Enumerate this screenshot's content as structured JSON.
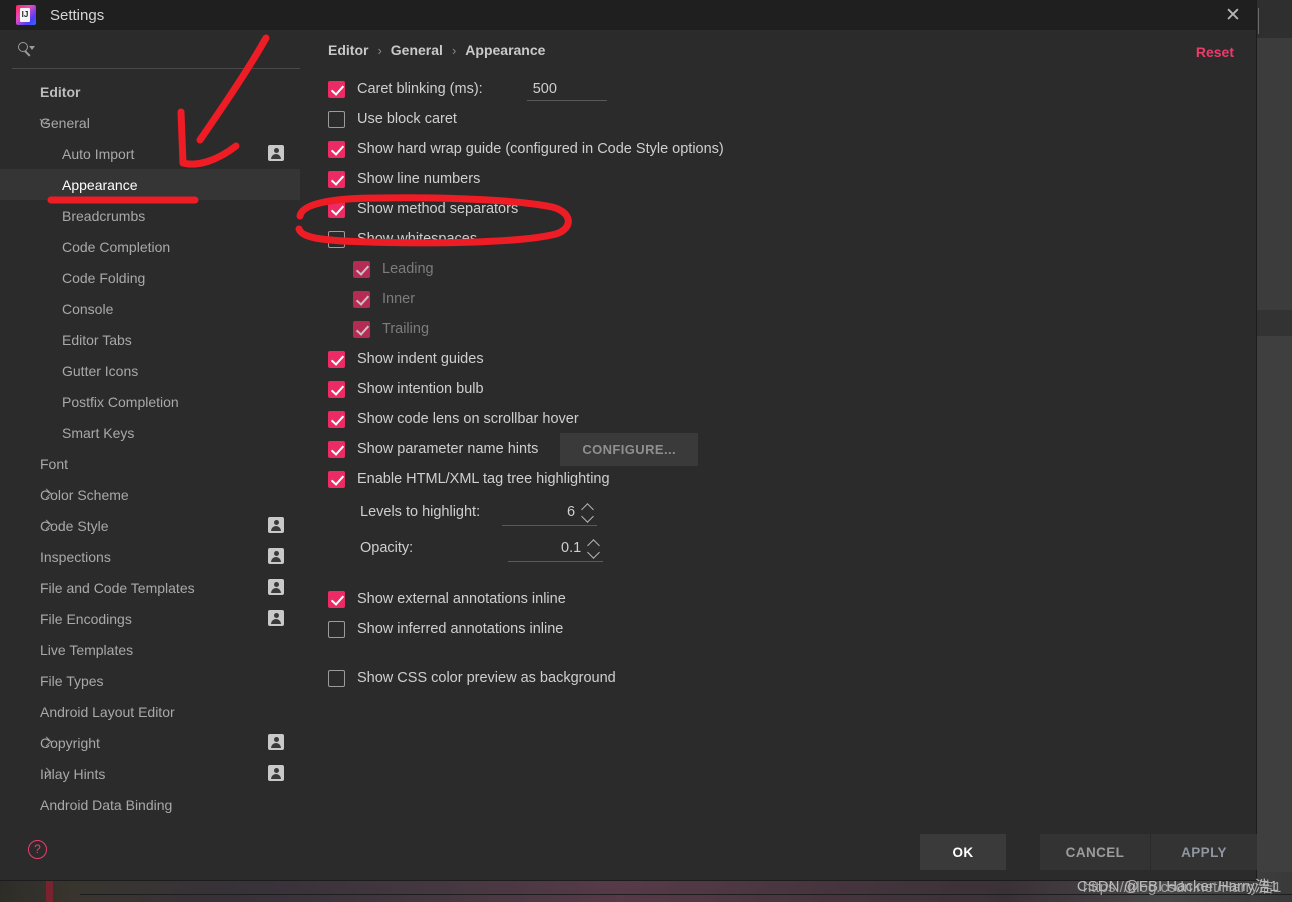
{
  "window": {
    "title": "Settings",
    "logo_icon": "intellij-idea-logo",
    "close_icon": "close-icon"
  },
  "sidebar": {
    "search": {
      "placeholder": "",
      "value": "",
      "icon": "search-icon"
    },
    "items": [
      {
        "label": "Editor",
        "level": 0,
        "chevron": "",
        "badge": false,
        "selected": false
      },
      {
        "label": "General",
        "level": 1,
        "chevron": "open",
        "badge": false,
        "selected": false
      },
      {
        "label": "Auto Import",
        "level": 2,
        "chevron": "",
        "badge": true,
        "selected": false
      },
      {
        "label": "Appearance",
        "level": 2,
        "chevron": "",
        "badge": false,
        "selected": true
      },
      {
        "label": "Breadcrumbs",
        "level": 2,
        "chevron": "",
        "badge": false,
        "selected": false
      },
      {
        "label": "Code Completion",
        "level": 2,
        "chevron": "",
        "badge": false,
        "selected": false
      },
      {
        "label": "Code Folding",
        "level": 2,
        "chevron": "",
        "badge": false,
        "selected": false
      },
      {
        "label": "Console",
        "level": 2,
        "chevron": "",
        "badge": false,
        "selected": false
      },
      {
        "label": "Editor Tabs",
        "level": 2,
        "chevron": "",
        "badge": false,
        "selected": false
      },
      {
        "label": "Gutter Icons",
        "level": 2,
        "chevron": "",
        "badge": false,
        "selected": false
      },
      {
        "label": "Postfix Completion",
        "level": 2,
        "chevron": "",
        "badge": false,
        "selected": false
      },
      {
        "label": "Smart Keys",
        "level": 2,
        "chevron": "",
        "badge": false,
        "selected": false
      },
      {
        "label": "Font",
        "level": 1,
        "chevron": "",
        "badge": false,
        "selected": false
      },
      {
        "label": "Color Scheme",
        "level": 1,
        "chevron": "closed",
        "badge": false,
        "selected": false
      },
      {
        "label": "Code Style",
        "level": 1,
        "chevron": "closed",
        "badge": true,
        "selected": false
      },
      {
        "label": "Inspections",
        "level": 1,
        "chevron": "",
        "badge": true,
        "selected": false
      },
      {
        "label": "File and Code Templates",
        "level": 1,
        "chevron": "",
        "badge": true,
        "selected": false
      },
      {
        "label": "File Encodings",
        "level": 1,
        "chevron": "",
        "badge": true,
        "selected": false
      },
      {
        "label": "Live Templates",
        "level": 1,
        "chevron": "",
        "badge": false,
        "selected": false
      },
      {
        "label": "File Types",
        "level": 1,
        "chevron": "",
        "badge": false,
        "selected": false
      },
      {
        "label": "Android Layout Editor",
        "level": 1,
        "chevron": "",
        "badge": false,
        "selected": false
      },
      {
        "label": "Copyright",
        "level": 1,
        "chevron": "closed",
        "badge": true,
        "selected": false
      },
      {
        "label": "Inlay Hints",
        "level": 1,
        "chevron": "closed",
        "badge": true,
        "selected": false
      },
      {
        "label": "Android Data Binding",
        "level": 1,
        "chevron": "",
        "badge": false,
        "selected": false
      }
    ]
  },
  "main": {
    "breadcrumb": [
      "Editor",
      "General",
      "Appearance"
    ],
    "breadcrumb_separator": "›",
    "reset_label": "Reset",
    "options": [
      {
        "label": "Caret blinking (ms):",
        "checked": true,
        "disabled": false,
        "sub": false,
        "field": "500"
      },
      {
        "label": "Use block caret",
        "checked": false,
        "disabled": false,
        "sub": false
      },
      {
        "label": "Show hard wrap guide (configured in Code Style options)",
        "checked": true,
        "disabled": false,
        "sub": false
      },
      {
        "label": "Show line numbers",
        "checked": true,
        "disabled": false,
        "sub": false
      },
      {
        "label": "Show method separators",
        "checked": true,
        "disabled": false,
        "sub": false
      },
      {
        "label": "Show whitespaces",
        "checked": false,
        "disabled": false,
        "sub": false
      },
      {
        "label": "Leading",
        "checked": true,
        "disabled": true,
        "sub": true
      },
      {
        "label": "Inner",
        "checked": true,
        "disabled": true,
        "sub": true
      },
      {
        "label": "Trailing",
        "checked": true,
        "disabled": true,
        "sub": true
      },
      {
        "label": "Show indent guides",
        "checked": true,
        "disabled": false,
        "sub": false
      },
      {
        "label": "Show intention bulb",
        "checked": true,
        "disabled": false,
        "sub": false
      },
      {
        "label": "Show code lens on scrollbar hover",
        "checked": true,
        "disabled": false,
        "sub": false
      },
      {
        "label": "Show parameter name hints",
        "checked": true,
        "disabled": false,
        "sub": false,
        "button": "CONFIGURE..."
      },
      {
        "label": "Enable HTML/XML tag tree highlighting",
        "checked": true,
        "disabled": false,
        "sub": false
      }
    ],
    "spinners": [
      {
        "label": "Levels to highlight:",
        "value": "6"
      },
      {
        "label": "Opacity:",
        "value": "0.1"
      }
    ],
    "options_tail": [
      {
        "label": "Show external annotations inline",
        "checked": true,
        "disabled": false
      },
      {
        "label": "Show inferred annotations inline",
        "checked": false,
        "disabled": false
      },
      {
        "label": "Show CSS color preview as background",
        "checked": false,
        "disabled": false
      }
    ]
  },
  "footer": {
    "help_icon": "help-circle-icon",
    "ok_label": "OK",
    "cancel_label": "CANCEL",
    "apply_label": "APPLY"
  },
  "annotations": {
    "ink_color": "#ee1c25",
    "marks": [
      "arrow-to-appearance",
      "underline-appearance",
      "ellipse-show-method-separators"
    ]
  },
  "watermark": {
    "line_a": "CSDN @FBI Hacker Harry浩1",
    "line_b": "https://blog.csdn.net/Harry浩1"
  },
  "colors": {
    "accent_pink": "#ec2b64",
    "dialog_bg": "#2b2b2b",
    "titlebar_bg": "#1f1f1f",
    "selected_row": "#353535"
  }
}
